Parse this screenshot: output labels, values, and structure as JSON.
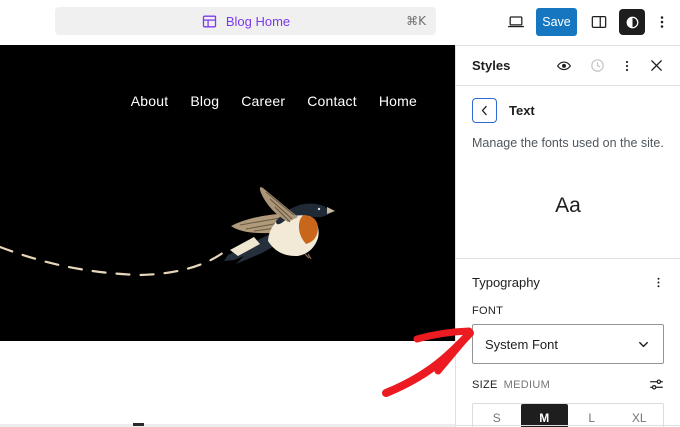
{
  "top_bar": {
    "command": {
      "label": "Blog Home",
      "shortcut": "⌘K",
      "icon": "template-icon"
    },
    "save_label": "Save",
    "icons": [
      "laptop-preview-icon",
      "sidebar-toggle-icon",
      "contrast-styles-icon",
      "more-options-icon"
    ]
  },
  "canvas": {
    "nav_items": [
      "About",
      "Blog",
      "Career",
      "Contact",
      "Home"
    ],
    "artwork": "flying-swallow-with-dashed-flight-path"
  },
  "sidebar": {
    "title": "Styles",
    "header_icons": [
      "style-book-eye-icon",
      "revisions-clock-icon",
      "more-options-icon",
      "close-icon"
    ],
    "screen_title": "Text",
    "back_icon": "chevron-left-icon",
    "description": "Manage the fonts used on the site.",
    "preview_text": "Aa",
    "typography": {
      "title": "Typography",
      "menu_icon": "more-options-icon",
      "font_label": "FONT",
      "font_value": "System Font",
      "font_select_icon": "chevron-down-icon",
      "size_label": "SIZE",
      "size_value": "MEDIUM",
      "size_settings_icon": "sliders-settings-icon",
      "size_options": [
        "S",
        "M",
        "L",
        "XL"
      ],
      "size_selected": "M"
    }
  },
  "annotation": {
    "type": "hand-drawn-red-arrow",
    "points_to": "font-select"
  },
  "colors": {
    "save_blue": "#1677c0",
    "template_purple": "#7c3aed",
    "annotation_red": "#ec1b21",
    "selected_black": "#1e1e1e",
    "hero_background": "#000000",
    "flight_path_cream": "#e6d7ba"
  }
}
